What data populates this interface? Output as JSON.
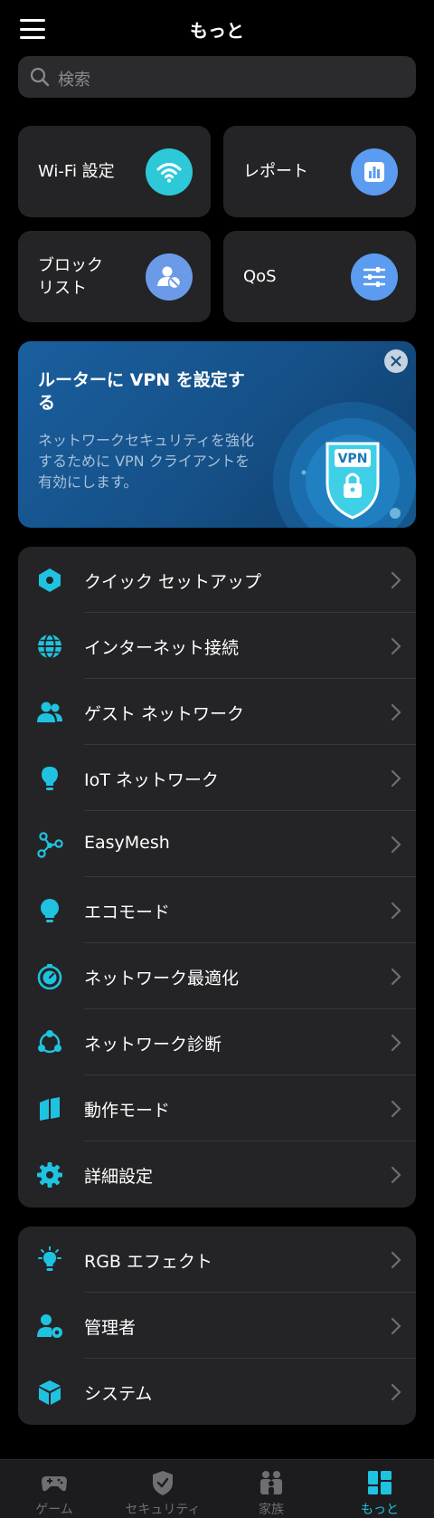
{
  "header": {
    "title": "もっと"
  },
  "search": {
    "placeholder": "検索"
  },
  "tiles": [
    {
      "label": "Wi-Fi 設定",
      "icon": "wifi-icon",
      "color": "#2ec9d9"
    },
    {
      "label": "レポート",
      "icon": "report-chart-icon",
      "color": "#5b9cf0"
    },
    {
      "label": "ブロック\nリスト",
      "icon": "block-user-icon",
      "color": "#6b9be8"
    },
    {
      "label": "QoS",
      "icon": "sliders-icon",
      "color": "#5b9cf0"
    }
  ],
  "vpn_banner": {
    "title": "ルーターに VPN を設定する",
    "description": "ネットワークセキュリティを強化するために VPN クライアントを有効にします。",
    "badge": "VPN"
  },
  "list1": [
    {
      "label": "クイック セットアップ",
      "icon": "hexagon-setup-icon"
    },
    {
      "label": "インターネット接続",
      "icon": "globe-icon"
    },
    {
      "label": "ゲスト ネットワーク",
      "icon": "guest-users-icon"
    },
    {
      "label": "IoT ネットワーク",
      "icon": "iot-bulb-icon"
    },
    {
      "label": "EasyMesh",
      "icon": "mesh-nodes-icon"
    },
    {
      "label": "エコモード",
      "icon": "eco-bulb-icon"
    },
    {
      "label": "ネットワーク最適化",
      "icon": "optimize-gauge-icon"
    },
    {
      "label": "ネットワーク診断",
      "icon": "diagnosis-icon"
    },
    {
      "label": "動作モード",
      "icon": "operation-mode-icon"
    },
    {
      "label": "詳細設定",
      "icon": "gear-icon"
    }
  ],
  "list2": [
    {
      "label": "RGB エフェクト",
      "icon": "rgb-bulb-icon"
    },
    {
      "label": "管理者",
      "icon": "admin-user-icon"
    },
    {
      "label": "システム",
      "icon": "system-cube-icon"
    }
  ],
  "tabs": [
    {
      "label": "ゲーム",
      "icon": "gamepad-icon",
      "active": false
    },
    {
      "label": "セキュリティ",
      "icon": "shield-icon",
      "active": false
    },
    {
      "label": "家族",
      "icon": "family-icon",
      "active": false
    },
    {
      "label": "もっと",
      "icon": "more-grid-icon",
      "active": true
    }
  ],
  "colors": {
    "accent": "#1fc3e0",
    "card": "#242426",
    "background": "#000000"
  }
}
